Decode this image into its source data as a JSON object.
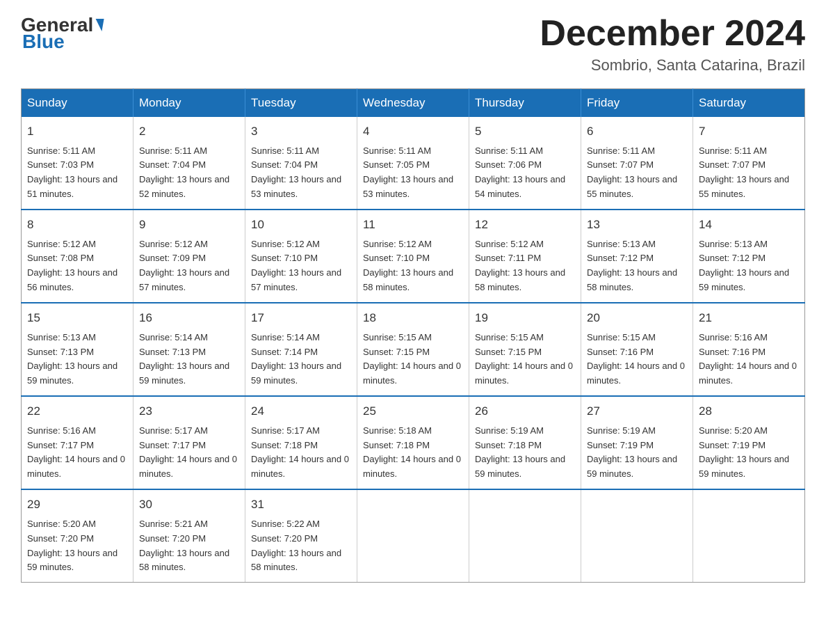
{
  "header": {
    "logo_general": "General",
    "logo_blue": "Blue",
    "month_title": "December 2024",
    "location": "Sombrio, Santa Catarina, Brazil"
  },
  "weekdays": [
    "Sunday",
    "Monday",
    "Tuesday",
    "Wednesday",
    "Thursday",
    "Friday",
    "Saturday"
  ],
  "weeks": [
    [
      {
        "day": "1",
        "sunrise": "5:11 AM",
        "sunset": "7:03 PM",
        "daylight": "13 hours and 51 minutes."
      },
      {
        "day": "2",
        "sunrise": "5:11 AM",
        "sunset": "7:04 PM",
        "daylight": "13 hours and 52 minutes."
      },
      {
        "day": "3",
        "sunrise": "5:11 AM",
        "sunset": "7:04 PM",
        "daylight": "13 hours and 53 minutes."
      },
      {
        "day": "4",
        "sunrise": "5:11 AM",
        "sunset": "7:05 PM",
        "daylight": "13 hours and 53 minutes."
      },
      {
        "day": "5",
        "sunrise": "5:11 AM",
        "sunset": "7:06 PM",
        "daylight": "13 hours and 54 minutes."
      },
      {
        "day": "6",
        "sunrise": "5:11 AM",
        "sunset": "7:07 PM",
        "daylight": "13 hours and 55 minutes."
      },
      {
        "day": "7",
        "sunrise": "5:11 AM",
        "sunset": "7:07 PM",
        "daylight": "13 hours and 55 minutes."
      }
    ],
    [
      {
        "day": "8",
        "sunrise": "5:12 AM",
        "sunset": "7:08 PM",
        "daylight": "13 hours and 56 minutes."
      },
      {
        "day": "9",
        "sunrise": "5:12 AM",
        "sunset": "7:09 PM",
        "daylight": "13 hours and 57 minutes."
      },
      {
        "day": "10",
        "sunrise": "5:12 AM",
        "sunset": "7:10 PM",
        "daylight": "13 hours and 57 minutes."
      },
      {
        "day": "11",
        "sunrise": "5:12 AM",
        "sunset": "7:10 PM",
        "daylight": "13 hours and 58 minutes."
      },
      {
        "day": "12",
        "sunrise": "5:12 AM",
        "sunset": "7:11 PM",
        "daylight": "13 hours and 58 minutes."
      },
      {
        "day": "13",
        "sunrise": "5:13 AM",
        "sunset": "7:12 PM",
        "daylight": "13 hours and 58 minutes."
      },
      {
        "day": "14",
        "sunrise": "5:13 AM",
        "sunset": "7:12 PM",
        "daylight": "13 hours and 59 minutes."
      }
    ],
    [
      {
        "day": "15",
        "sunrise": "5:13 AM",
        "sunset": "7:13 PM",
        "daylight": "13 hours and 59 minutes."
      },
      {
        "day": "16",
        "sunrise": "5:14 AM",
        "sunset": "7:13 PM",
        "daylight": "13 hours and 59 minutes."
      },
      {
        "day": "17",
        "sunrise": "5:14 AM",
        "sunset": "7:14 PM",
        "daylight": "13 hours and 59 minutes."
      },
      {
        "day": "18",
        "sunrise": "5:15 AM",
        "sunset": "7:15 PM",
        "daylight": "14 hours and 0 minutes."
      },
      {
        "day": "19",
        "sunrise": "5:15 AM",
        "sunset": "7:15 PM",
        "daylight": "14 hours and 0 minutes."
      },
      {
        "day": "20",
        "sunrise": "5:15 AM",
        "sunset": "7:16 PM",
        "daylight": "14 hours and 0 minutes."
      },
      {
        "day": "21",
        "sunrise": "5:16 AM",
        "sunset": "7:16 PM",
        "daylight": "14 hours and 0 minutes."
      }
    ],
    [
      {
        "day": "22",
        "sunrise": "5:16 AM",
        "sunset": "7:17 PM",
        "daylight": "14 hours and 0 minutes."
      },
      {
        "day": "23",
        "sunrise": "5:17 AM",
        "sunset": "7:17 PM",
        "daylight": "14 hours and 0 minutes."
      },
      {
        "day": "24",
        "sunrise": "5:17 AM",
        "sunset": "7:18 PM",
        "daylight": "14 hours and 0 minutes."
      },
      {
        "day": "25",
        "sunrise": "5:18 AM",
        "sunset": "7:18 PM",
        "daylight": "14 hours and 0 minutes."
      },
      {
        "day": "26",
        "sunrise": "5:19 AM",
        "sunset": "7:18 PM",
        "daylight": "13 hours and 59 minutes."
      },
      {
        "day": "27",
        "sunrise": "5:19 AM",
        "sunset": "7:19 PM",
        "daylight": "13 hours and 59 minutes."
      },
      {
        "day": "28",
        "sunrise": "5:20 AM",
        "sunset": "7:19 PM",
        "daylight": "13 hours and 59 minutes."
      }
    ],
    [
      {
        "day": "29",
        "sunrise": "5:20 AM",
        "sunset": "7:20 PM",
        "daylight": "13 hours and 59 minutes."
      },
      {
        "day": "30",
        "sunrise": "5:21 AM",
        "sunset": "7:20 PM",
        "daylight": "13 hours and 58 minutes."
      },
      {
        "day": "31",
        "sunrise": "5:22 AM",
        "sunset": "7:20 PM",
        "daylight": "13 hours and 58 minutes."
      },
      null,
      null,
      null,
      null
    ]
  ]
}
